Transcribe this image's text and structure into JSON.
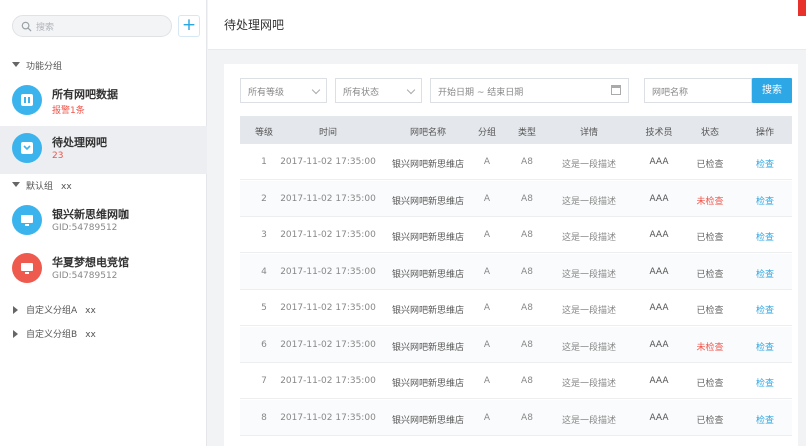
{
  "sidebar": {
    "search_placeholder": "搜索",
    "add_label": "+",
    "groups": [
      {
        "label": "功能分组",
        "extra": ""
      },
      {
        "label": "默认组",
        "extra": "xx"
      },
      {
        "label": "自定义分组A",
        "extra": "xx"
      },
      {
        "label": "自定义分组B",
        "extra": "xx"
      }
    ],
    "items": [
      {
        "title": "所有网吧数据",
        "sub": "报警1条",
        "color": "#3bb4ee"
      },
      {
        "title": "待处理网吧",
        "sub": "23",
        "color": "#3bb4ee"
      },
      {
        "title": "银兴新思维网咖",
        "sub": "GID:54789512",
        "color": "#3bb4ee"
      },
      {
        "title": "华夏梦想电竞馆",
        "sub": "GID:54789512",
        "color": "#ef5a4e"
      }
    ]
  },
  "header": {
    "title": "待处理网吧"
  },
  "filters": {
    "level": "所有等级",
    "status": "所有状态",
    "date_range": "开始日期 ~ 结束日期",
    "name_placeholder": "网吧名称",
    "search_button": "搜索"
  },
  "table": {
    "columns": [
      "等级",
      "时间",
      "网吧名称",
      "分组",
      "类型",
      "详情",
      "技术员",
      "状态",
      "操作"
    ],
    "rows": [
      [
        "1",
        "2017-11-02 17:35:00",
        "银兴网吧新思维店",
        "A",
        "A8",
        "这是一段描述",
        "AAA",
        "已检查",
        "检查"
      ],
      [
        "2",
        "2017-11-02 17:35:00",
        "银兴网吧新思维店",
        "A",
        "A8",
        "这是一段描述",
        "AAA",
        "未检查",
        "检查"
      ],
      [
        "3",
        "2017-11-02 17:35:00",
        "银兴网吧新思维店",
        "A",
        "A8",
        "这是一段描述",
        "AAA",
        "已检查",
        "检查"
      ],
      [
        "4",
        "2017-11-02 17:35:00",
        "银兴网吧新思维店",
        "A",
        "A8",
        "这是一段描述",
        "AAA",
        "已检查",
        "检查"
      ],
      [
        "5",
        "2017-11-02 17:35:00",
        "银兴网吧新思维店",
        "A",
        "A8",
        "这是一段描述",
        "AAA",
        "已检查",
        "检查"
      ],
      [
        "6",
        "2017-11-02 17:35:00",
        "银兴网吧新思维店",
        "A",
        "A8",
        "这是一段描述",
        "AAA",
        "未检查",
        "检查"
      ],
      [
        "7",
        "2017-11-02 17:35:00",
        "银兴网吧新思维店",
        "A",
        "A8",
        "这是一段描述",
        "AAA",
        "已检查",
        "检查"
      ],
      [
        "8",
        "2017-11-02 17:35:00",
        "银兴网吧新思维店",
        "A",
        "A8",
        "这是一段描述",
        "AAA",
        "已检查",
        "检查"
      ]
    ]
  },
  "colors": {
    "accent": "#2ea7e6",
    "alert": "#f0554a"
  }
}
